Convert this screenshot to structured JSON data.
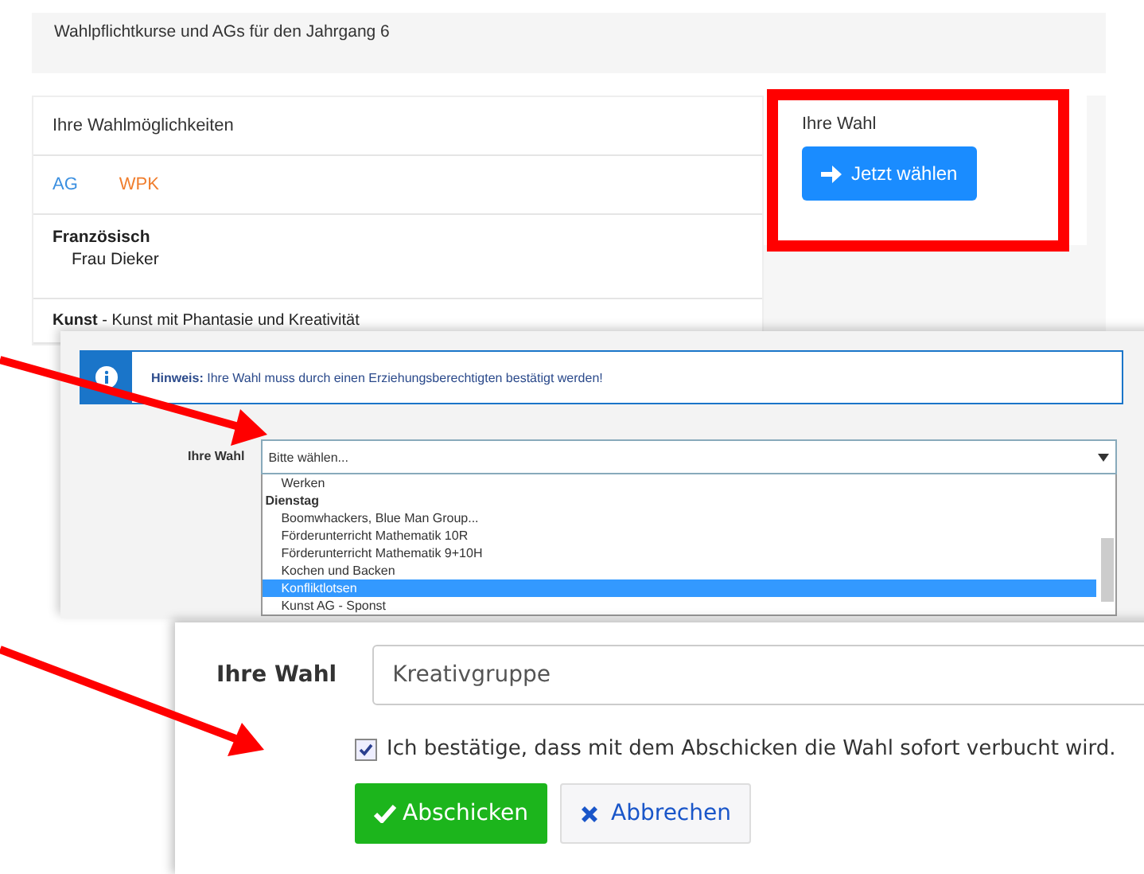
{
  "page": {
    "header": "Wahlpflichtkurse und AGs für den Jahrgang 6",
    "options_card": {
      "title": "Ihre Wahlmöglichkeiten",
      "filters": [
        {
          "label": "AG",
          "color": "#3b8fe0"
        },
        {
          "label": "WPK",
          "color": "#f07e2e"
        }
      ],
      "courses": [
        {
          "name": "Französisch",
          "teacher": "Frau Dieker"
        },
        {
          "text": "**Kunst** - Kunst mit Phantasie und Kreativität"
        }
      ]
    },
    "choice_card": {
      "title": "Ihre Wahl",
      "button": "Jetzt wählen",
      "highlighted": true
    }
  },
  "dialog": {
    "notice": "**Hinweis:** Ihre Wahl muss durch einen Erziehungsberechtigten bestätigt werden!",
    "label": "Ihre Wahl",
    "select_placeholder": "Bitte wählen...",
    "options": [
      {
        "kind": "option",
        "label": "Werken",
        "selected": false
      },
      {
        "kind": "group",
        "label": "Dienstag",
        "selected": false
      },
      {
        "kind": "option",
        "label": "Boomwhackers, Blue Man Group...",
        "selected": false
      },
      {
        "kind": "option",
        "label": "Förderunterricht Mathematik 10R",
        "selected": false
      },
      {
        "kind": "option",
        "label": "Förderunterricht Mathematik 9+10H",
        "selected": false
      },
      {
        "kind": "option",
        "label": "Kochen und Backen",
        "selected": false
      },
      {
        "kind": "option",
        "label": "Konfliktlotsen",
        "selected": true
      },
      {
        "kind": "option",
        "label": "Kunst AG - Sponst",
        "selected": false
      }
    ]
  },
  "confirm": {
    "label": "Ihre Wahl",
    "value": "Kreativgruppe",
    "checkbox": {
      "label": "Ich bestätige, dass mit dem Abschicken die Wahl sofort verbucht wird.",
      "checked": true
    },
    "buttons": [
      {
        "kind": "submit",
        "label": "Abschicken"
      },
      {
        "kind": "cancel",
        "label": "Abbrechen"
      }
    ]
  }
}
